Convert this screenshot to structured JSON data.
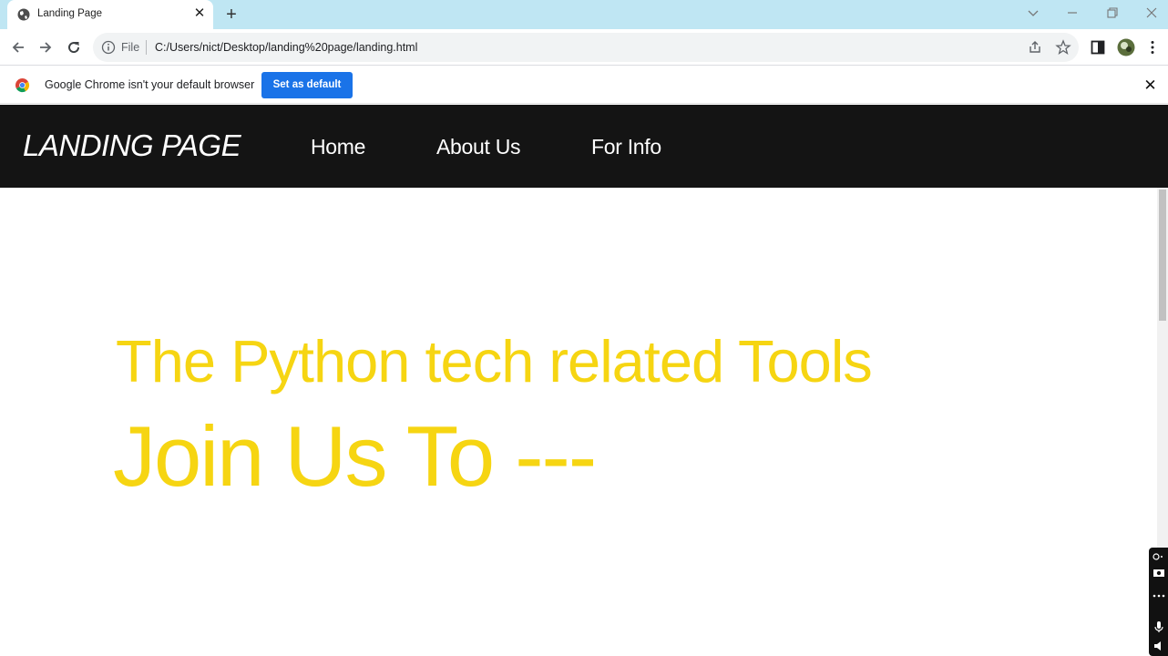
{
  "browser": {
    "tab": {
      "title": "Landing Page"
    },
    "address": {
      "scheme": "File",
      "url": "C:/Users/nict/Desktop/landing%20page/landing.html"
    },
    "infobar": {
      "message": "Google Chrome isn't your default browser",
      "button": "Set as default"
    }
  },
  "site": {
    "brand": "LANDING PAGE",
    "nav": [
      "Home",
      "About Us",
      "For Info"
    ],
    "hero": {
      "line1": "The Python tech related Tools",
      "line2": "Join Us To ---"
    }
  },
  "colors": {
    "accent": "#f6d512",
    "navbar": "#141414",
    "tabstrip": "#bfe6f3",
    "infobar_button": "#1a73e8"
  }
}
